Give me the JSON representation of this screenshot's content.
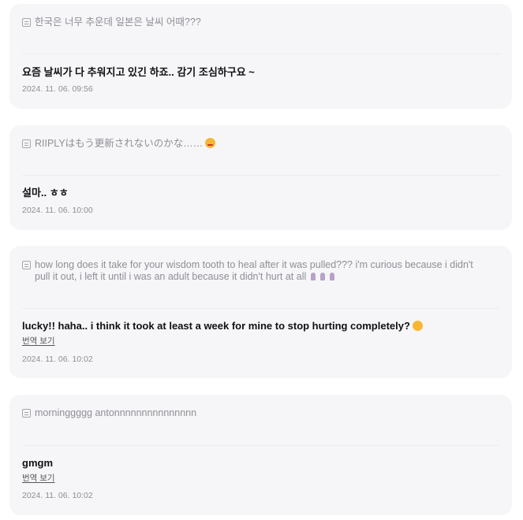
{
  "posts": [
    {
      "question": "한국은 너무 추운데 일본은 날씨 어때???",
      "answer": "요즘 날씨가 다 추워지고 있긴 하죠.. 감기 조심하구요 ~",
      "translate_label": "",
      "date": "2024. 11. 06. 09:56"
    },
    {
      "question": "RIIPLYはもう更新されないのかな……",
      "answer": "설마.. ㅎㅎ",
      "translate_label": "",
      "date": "2024. 11. 06. 10:00"
    },
    {
      "question": "how long does it take for your wisdom tooth to heal after it was pulled??? i'm curious because i didn't pull it out, i left it until i was an adult because it didn't hurt at all",
      "answer": "lucky!! haha.. i think it took at least a week for mine to stop hurting completely?",
      "translate_label": "번역 보기",
      "date": "2024. 11. 06. 10:02"
    },
    {
      "question": "morninggggg antonnnnnnnnnnnnnnn",
      "answer": "gmgm",
      "translate_label": "번역 보기",
      "date": "2024. 11. 06. 10:02"
    }
  ],
  "icons": {
    "question": "note-icon",
    "emoji_face": "flushed-face-emoji",
    "emoji_answer": "sweat-smile-emoji",
    "tooth": "tooth-emoji"
  }
}
